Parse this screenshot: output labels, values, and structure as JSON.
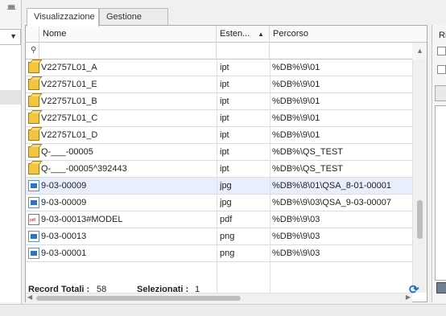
{
  "tabs": [
    {
      "label": "Visualizzazione",
      "active": true
    },
    {
      "label": "Gestione",
      "active": false
    }
  ],
  "columns": {
    "name": "Nome",
    "ext": "Esten...",
    "path": "Percorso"
  },
  "rows": [
    {
      "icon": "part-icon",
      "name": "V22757L01_A",
      "ext": "ipt",
      "path": "%DB%\\9\\01",
      "selected": false
    },
    {
      "icon": "part-icon",
      "name": "V22757L01_E",
      "ext": "ipt",
      "path": "%DB%\\9\\01",
      "selected": false
    },
    {
      "icon": "part-icon",
      "name": "V22757L01_B",
      "ext": "ipt",
      "path": "%DB%\\9\\01",
      "selected": false
    },
    {
      "icon": "part-icon",
      "name": "V22757L01_C",
      "ext": "ipt",
      "path": "%DB%\\9\\01",
      "selected": false
    },
    {
      "icon": "part-icon",
      "name": "V22757L01_D",
      "ext": "ipt",
      "path": "%DB%\\9\\01",
      "selected": false
    },
    {
      "icon": "part-icon",
      "name": "Q-___-00005",
      "ext": "ipt",
      "path": "%DB%\\QS_TEST",
      "selected": false
    },
    {
      "icon": "part-icon",
      "name": "Q-___-00005^392443",
      "ext": "ipt",
      "path": "%DB%\\QS_TEST",
      "selected": false
    },
    {
      "icon": "image-icon",
      "name": "9-03-00009",
      "ext": "jpg",
      "path": "%DB%\\8\\01\\QSA_8-01-00001",
      "selected": true
    },
    {
      "icon": "image-icon",
      "name": "9-03-00009",
      "ext": "jpg",
      "path": "%DB%\\9\\03\\QSA_9-03-00007",
      "selected": false
    },
    {
      "icon": "pdf-icon",
      "name": "9-03-00013#MODEL",
      "ext": "pdf",
      "path": "%DB%\\9\\03",
      "selected": false
    },
    {
      "icon": "image-icon",
      "name": "9-03-00013",
      "ext": "png",
      "path": "%DB%\\9\\03",
      "selected": false
    },
    {
      "icon": "image-icon",
      "name": "9-03-00001",
      "ext": "png",
      "path": "%DB%\\9\\03",
      "selected": false
    }
  ],
  "status": {
    "total_label": "Record Totali :",
    "total_value": "58",
    "selected_label": "Selezionati :",
    "selected_value": "1"
  },
  "right_panel": {
    "label": "Ri"
  },
  "colors": {
    "selection": "#e8eefb",
    "accent": "#1b6dc1"
  }
}
